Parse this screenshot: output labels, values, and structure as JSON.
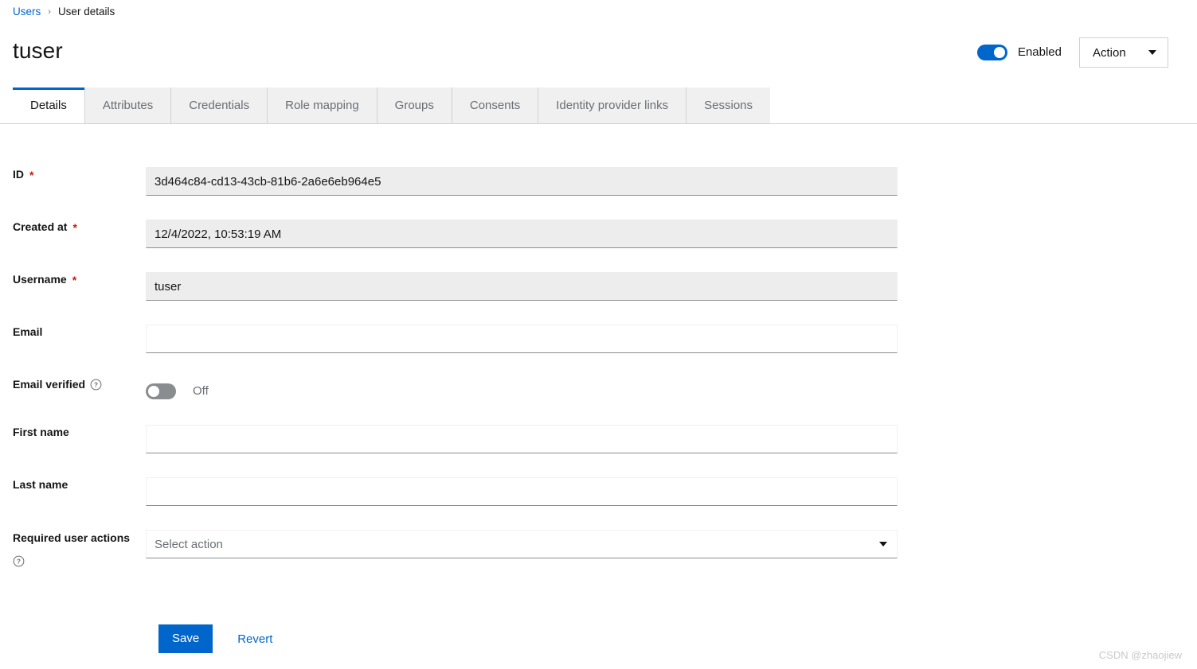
{
  "breadcrumb": {
    "parent": "Users",
    "separator": "›",
    "current": "User details"
  },
  "header": {
    "title": "tuser",
    "enabled_toggle": {
      "name": "enabled-switch",
      "state": "on",
      "label": "Enabled"
    },
    "action_button": {
      "label": "Action",
      "icon": "caret-down-icon"
    }
  },
  "tabs": [
    {
      "label": "Details",
      "active": true
    },
    {
      "label": "Attributes",
      "active": false
    },
    {
      "label": "Credentials",
      "active": false
    },
    {
      "label": "Role mapping",
      "active": false
    },
    {
      "label": "Groups",
      "active": false
    },
    {
      "label": "Consents",
      "active": false
    },
    {
      "label": "Identity provider links",
      "active": false
    },
    {
      "label": "Sessions",
      "active": false
    }
  ],
  "form": {
    "id": {
      "label": "ID",
      "required_marker": "*",
      "value": "3d464c84-cd13-43cb-81b6-2a6e6eb964e5"
    },
    "created_at": {
      "label": "Created at",
      "required_marker": "*",
      "value": "12/4/2022, 10:53:19 AM"
    },
    "username": {
      "label": "Username",
      "required_marker": "*",
      "value": "tuser"
    },
    "email": {
      "label": "Email",
      "value": "",
      "placeholder": ""
    },
    "email_verified": {
      "label": "Email verified",
      "help_icon": "help-circle-icon",
      "state": "off",
      "state_label": "Off"
    },
    "first_name": {
      "label": "First name",
      "value": "",
      "placeholder": ""
    },
    "last_name": {
      "label": "Last name",
      "value": "",
      "placeholder": ""
    },
    "required_user_actions": {
      "label": "Required user actions",
      "help_icon": "help-circle-icon",
      "placeholder": "Select action",
      "value": "",
      "caret_icon": "caret-down-icon"
    }
  },
  "actions": {
    "save_label": "Save",
    "revert_label": "Revert"
  },
  "watermark": "CSDN @zhaojiew",
  "colors": {
    "primary_blue": "#0066cc",
    "link_blue": "#06c",
    "required_red": "#c9190b",
    "readonly_bg": "#ededed",
    "toggle_off_gray": "#8a8d90",
    "muted_text": "#6a6e73"
  }
}
